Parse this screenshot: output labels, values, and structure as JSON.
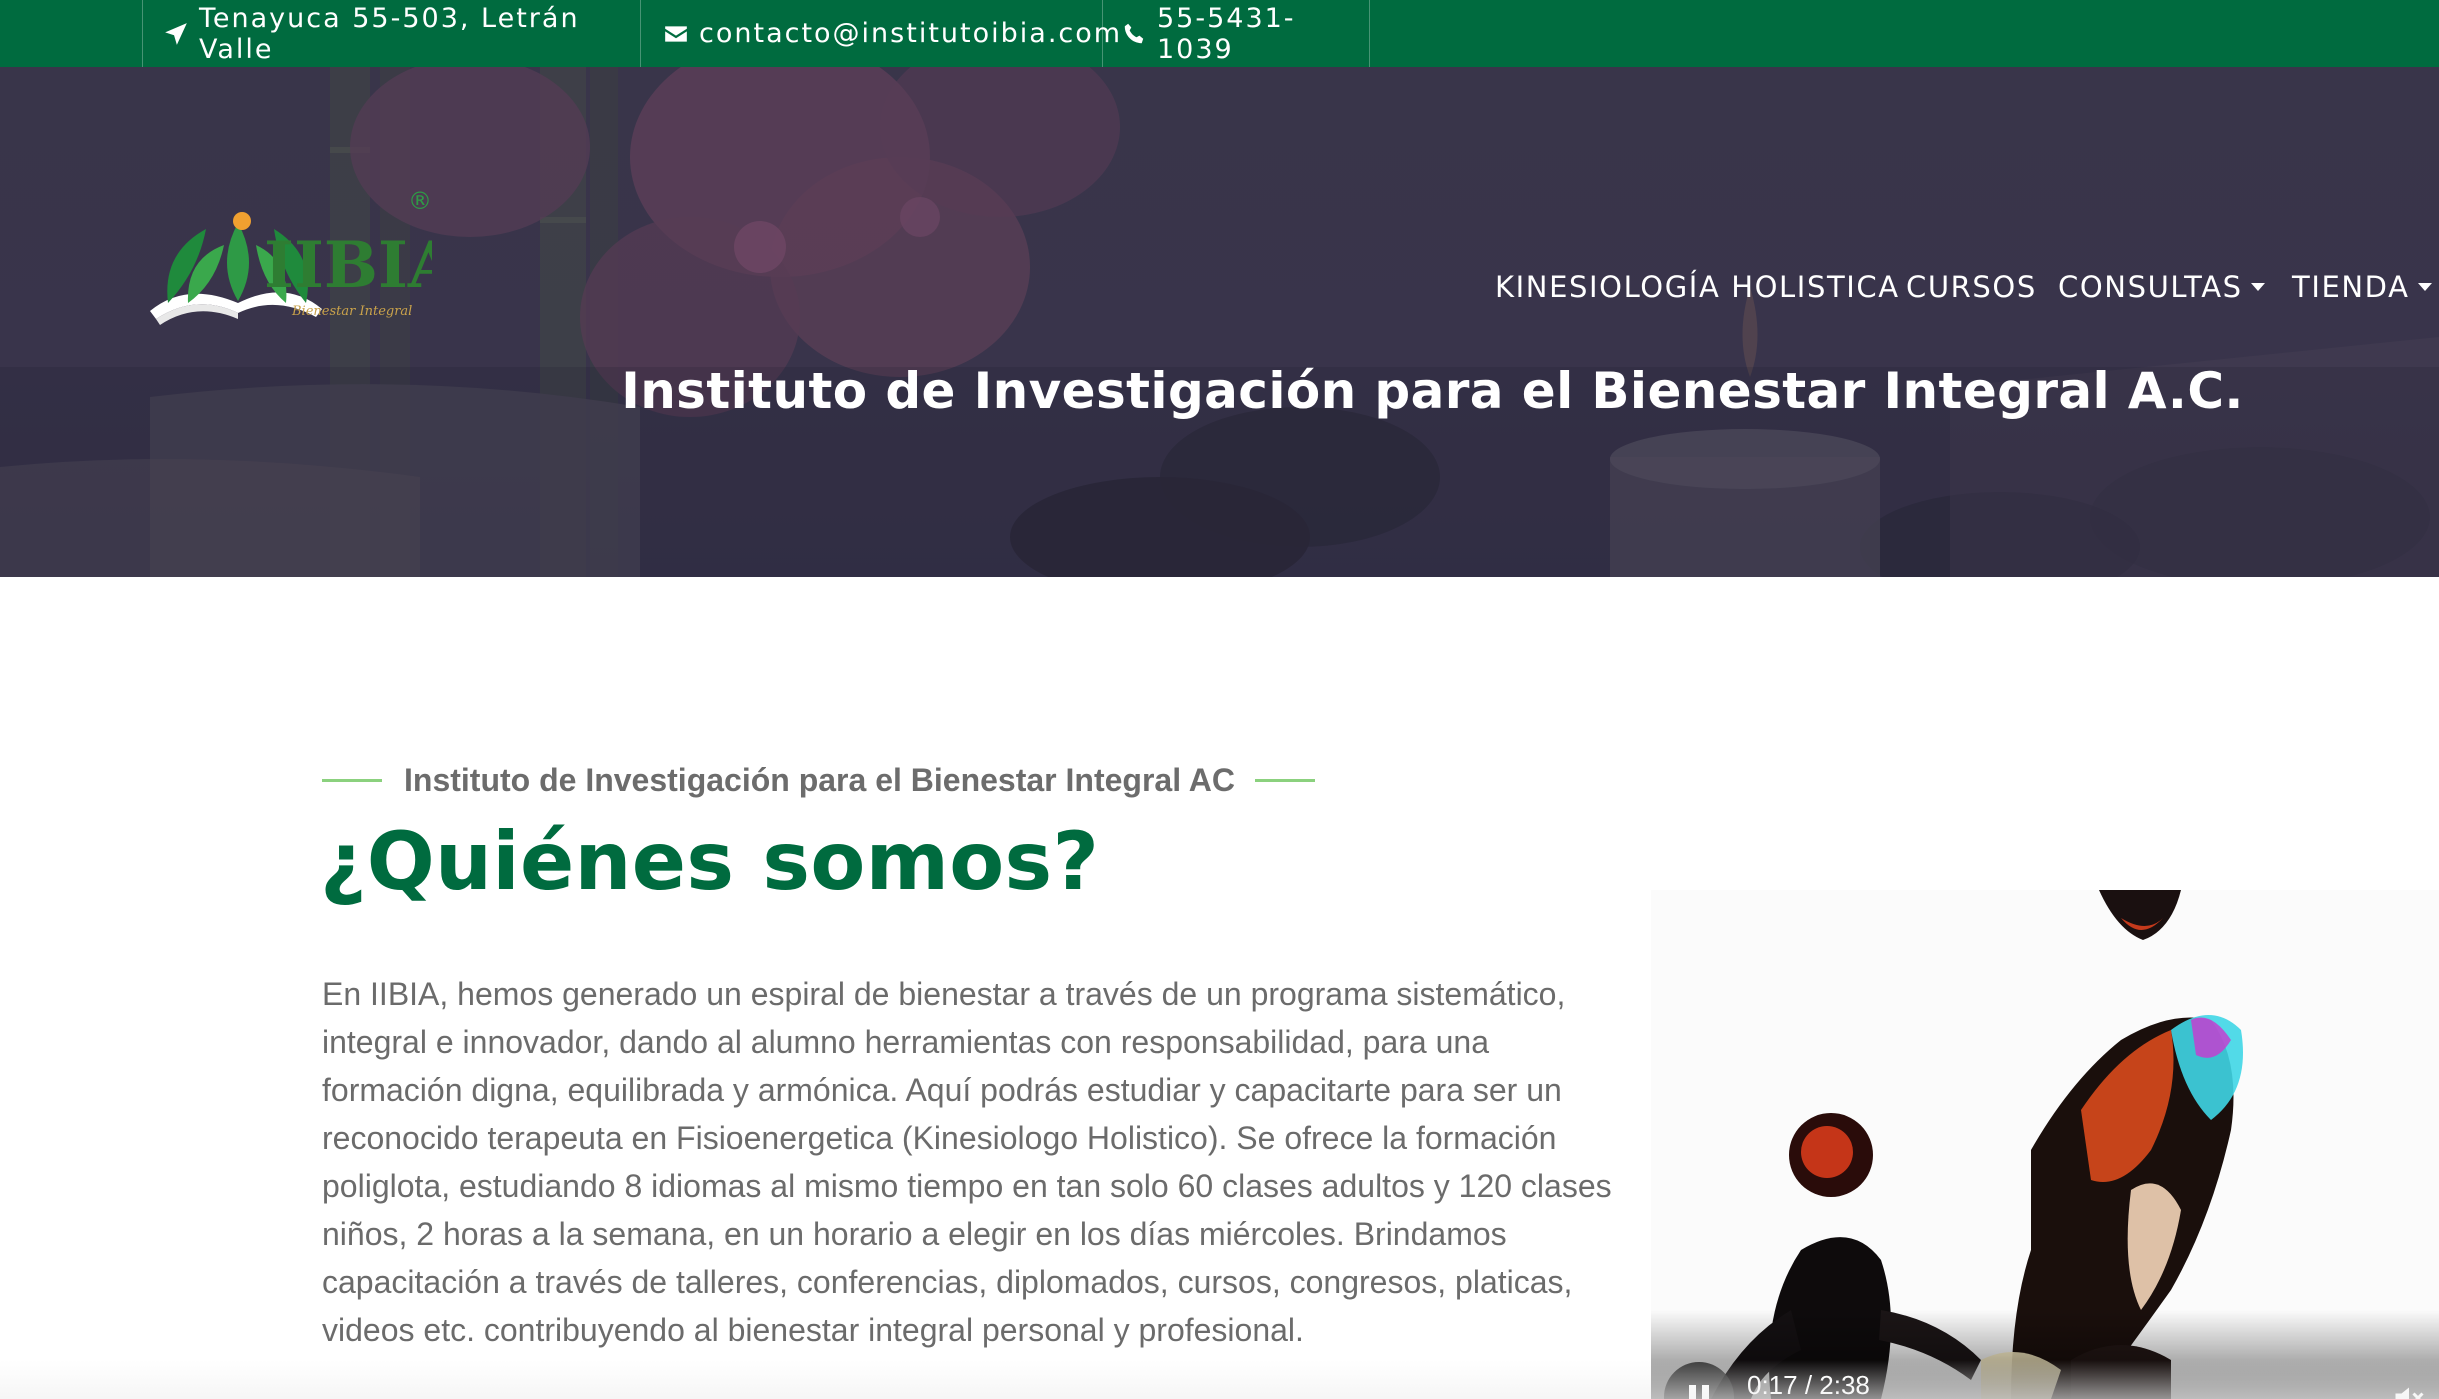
{
  "topbar": {
    "address": "Tenayuca 55-503, Letrán Valle",
    "email": "contacto@institutoibia.com",
    "phone": "55-5431-1039",
    "background": "#006b3f"
  },
  "logo": {
    "text": "IIBIA",
    "tagline": "Bienestar Integral",
    "registered": "®"
  },
  "nav": {
    "items": [
      {
        "label": "KINESIOLOGÍA HOLISTICA"
      },
      {
        "label": "CURSOS"
      },
      {
        "label": "CONSULTAS",
        "dropdown": true
      },
      {
        "label": "TIENDA",
        "dropdown": true
      }
    ]
  },
  "hero": {
    "title": "Instituto de Investigación para el Bienestar Integral A.C."
  },
  "about": {
    "eyebrow": "Instituto de Investigación para el Bienestar Integral AC",
    "title": "¿Quiénes somos?",
    "body": "En IIBIA, hemos generado un espiral de bienestar a través de un programa sistemático, integral e innovador, dando al alumno herramientas con responsabilidad, para una formación digna, equilibrada y armónica. Aquí podrás estudiar y capacitarte para ser un reconocido terapeuta en Fisioenergetica (Kinesiologo Holistico). Se ofrece la formación poliglota, estudiando 8 idiomas al mismo tiempo en tan solo 60 clases adultos y 120 clases niños, 2 horas a la semana, en un horario a elegir en los días miércoles. Brindamos capacitación a través de talleres, conferencias, diplomados, cursos, congresos, platicas, videos etc. contribuyendo al bienestar integral personal y profesional."
  },
  "video": {
    "time": "0:17 / 2:38",
    "state": "playing",
    "muted": true
  },
  "colors": {
    "accent_green": "#006b3f",
    "line_green": "#8bd17e",
    "text_gray": "#6b6b6b"
  }
}
